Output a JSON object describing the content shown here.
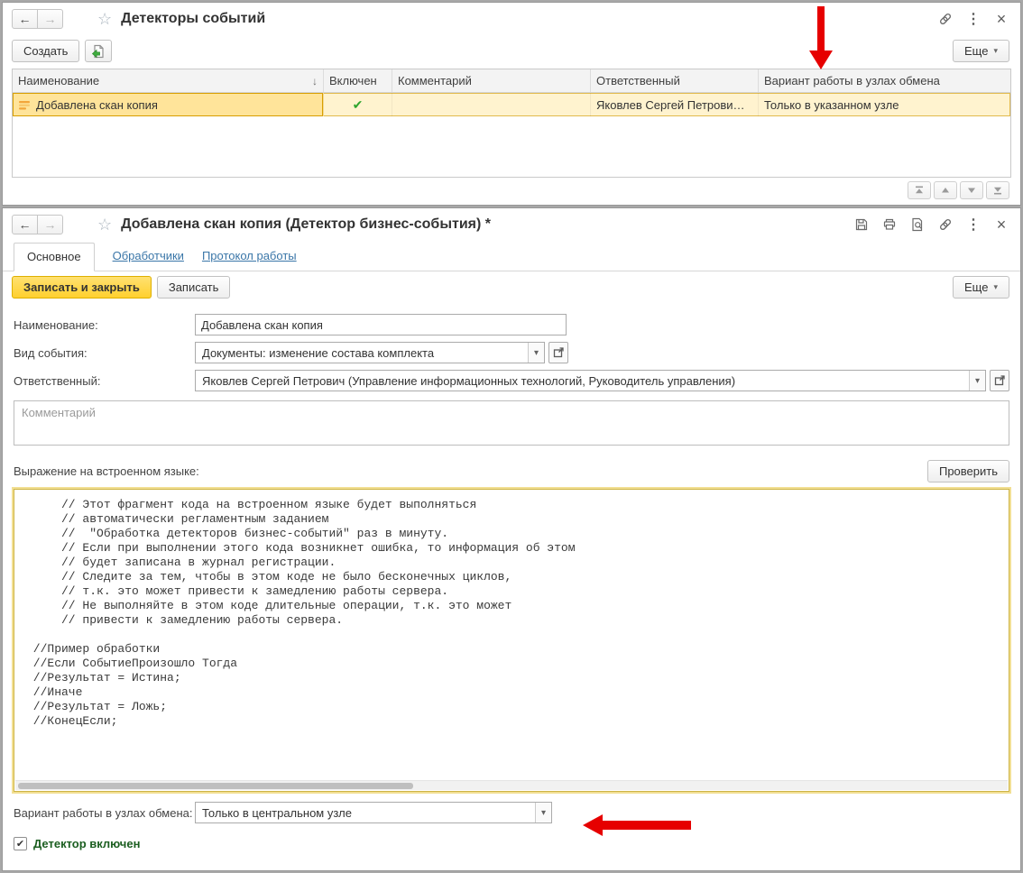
{
  "colors": {
    "accent_yellow": "#ffd335",
    "selected_row": "#fff3cf",
    "selected_cell": "#ffe49a",
    "link_blue": "#3a76a8",
    "enabled_check_green": "#2ea52e",
    "annotation_red": "#e60000",
    "bold_label_green": "#1b5e20"
  },
  "icons": {
    "back_arrow": "←",
    "forward_arrow": "→",
    "star": "☆",
    "kebab": "⋮",
    "close": "×",
    "dropdown": "▾",
    "sort_desc": "↓",
    "check": "✔"
  },
  "list_window": {
    "title": "Детекторы событий",
    "toolbar": {
      "create_label": "Создать",
      "more_label": "Еще"
    },
    "table": {
      "columns": [
        "Наименование",
        "Включен",
        "Комментарий",
        "Ответственный",
        "Вариант работы в узлах обмена"
      ],
      "rows": [
        {
          "name": "Добавлена скан копия",
          "enabled": true,
          "comment": "",
          "responsible": "Яковлев Сергей Петрови…",
          "exchange_node_mode": "Только в указанном узле"
        }
      ]
    }
  },
  "detail_window": {
    "title": "Добавлена скан копия (Детектор бизнес-события) *",
    "tabs": [
      "Основное",
      "Обработчики",
      "Протокол работы"
    ],
    "toolbar": {
      "save_close_label": "Записать и закрыть",
      "save_label": "Записать",
      "more_label": "Еще"
    },
    "fields": {
      "name": {
        "label": "Наименование:",
        "value": "Добавлена скан копия"
      },
      "event_kind": {
        "label": "Вид события:",
        "value": "Документы: изменение состава комплекта"
      },
      "responsible": {
        "label": "Ответственный:",
        "value": "Яковлев Сергей Петрович (Управление информационных технологий, Руководитель управления)"
      },
      "comment": {
        "placeholder": "Комментарий",
        "value": ""
      },
      "expression": {
        "label": "Выражение на встроенном языке:",
        "check_button_label": "Проверить",
        "code_lines": [
          "     // Этот фрагмент кода на встроенном языке будет выполняться",
          "     // автоматически регламентным заданием",
          "     //  \"Обработка детекторов бизнес-событий\" раз в минуту.",
          "     // Если при выполнении этого кода возникнет ошибка, то информация об этом",
          "     // будет записана в журнал регистрации.",
          "     // Следите за тем, чтобы в этом коде не было бесконечных циклов,",
          "     // т.к. это может привести к замедлению работы сервера.",
          "     // Не выполняйте в этом коде длительные операции, т.к. это может",
          "     // привести к замедлению работы сервера.",
          "",
          " //Пример обработки",
          " //Если СобытиеПроизошло Тогда",
          " //Результат = Истина;",
          " //Иначе",
          " //Результат = Ложь;",
          " //КонецЕсли;"
        ]
      },
      "exchange_node_mode": {
        "label": "Вариант работы в узлах обмена:",
        "value": "Только в центральном узле"
      },
      "detector_enabled": {
        "label": "Детектор включен",
        "checked": true
      }
    }
  }
}
